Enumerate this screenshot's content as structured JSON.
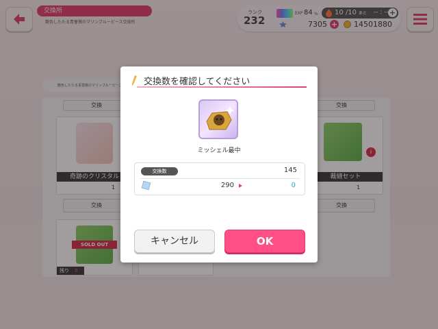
{
  "header": {
    "title": "交換所",
    "subtitle": "艶色したたる青薔薇のマリンブルーピース交換所",
    "rank_label": "ランク",
    "rank_value": "232",
    "exp_label": "EXP",
    "exp_value": "84",
    "exp_unit": "%",
    "stamina_value": "10 /10",
    "stamina_after_label": "あと",
    "stamina_time": "-- : --",
    "gems": "7305",
    "coins": "14501880"
  },
  "background": {
    "sub_banner": "艶色したたる青薔薇のマリンブルーピース",
    "cards": [
      {
        "name": "奇跡のクリスタル",
        "count": "1",
        "button": "交換"
      },
      {
        "name": "裁縫セット",
        "count": "1",
        "button": "交換"
      }
    ],
    "top_buttons": [
      "交換",
      "交換"
    ],
    "sold_out_label": "SOLD OUT",
    "remaining_label": "残り",
    "remaining_value": "0"
  },
  "modal": {
    "title": "交換数を確認してください",
    "item_name": "ミッシェル最中",
    "quantity_label": "交換数",
    "quantity_value": "145",
    "cost_value": "290",
    "after_value": "0",
    "cancel_label": "キャンセル",
    "ok_label": "OK"
  },
  "colors": {
    "accent": "#e0406e",
    "ok_button": "#ff4f86",
    "after_value": "#2aa7d6"
  }
}
